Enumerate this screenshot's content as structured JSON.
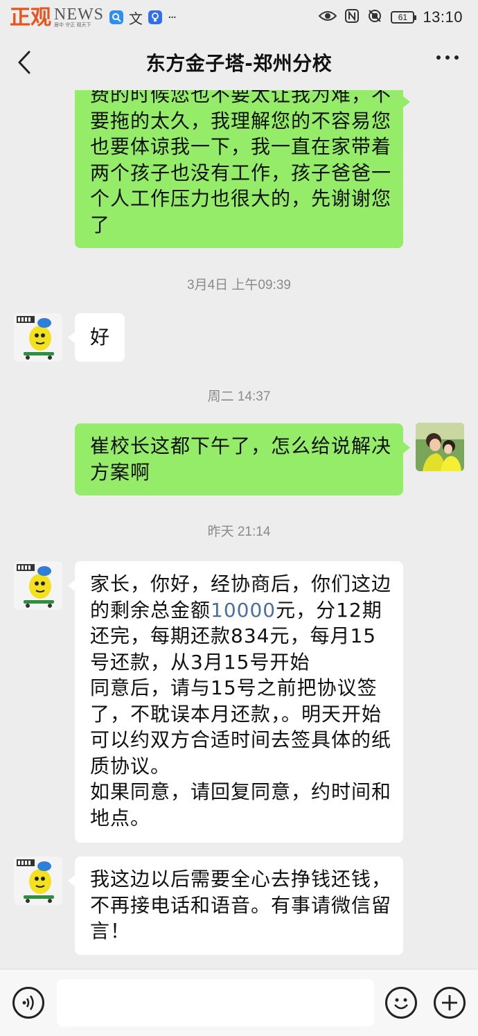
{
  "status_bar": {
    "watermark_main": "正观",
    "watermark_news": "NEWS",
    "watermark_slogan": "居中 守正 观天下",
    "icons": [
      "qq-icon",
      "translate-icon",
      "lightbulb-icon",
      "more-dots-icon",
      "eye-icon",
      "nfc-icon",
      "silent-icon",
      "battery-icon"
    ],
    "translate_glyph": "文",
    "more_glyph": "···",
    "battery_level": "61",
    "time": "13:10"
  },
  "nav": {
    "title": "东方金子塔-郑州分校"
  },
  "messages": [
    {
      "side": "right",
      "lines": [
        "费的时候您也不要太让我为难，不",
        "要拖的太久，我理解您的不容易您",
        "也要体谅我一下，我一直在家带着",
        "两个孩子也没有工作，孩子爸爸一",
        "个人工作压力也很大的，先谢谢您",
        "了"
      ]
    },
    {
      "timestamp": "3月4日 上午09:39"
    },
    {
      "side": "left",
      "lines": [
        "好"
      ]
    },
    {
      "timestamp": "周二 14:37"
    },
    {
      "side": "right",
      "lines": [
        "崔校长这都下午了，怎么给说解决",
        "方案啊"
      ]
    },
    {
      "timestamp": "昨天 21:14"
    },
    {
      "side": "left",
      "lines": [
        "家长，你好，经协商后，你们这边",
        "的剩余总金额10000元，分12期",
        "还完，每期还款834元，每月15",
        "号还款，从3月15号开始",
        "同意后，请与15号之前把协议签",
        "了，不耽误本月还款，。明天开始",
        "可以约双方合适时间去签具体的纸",
        "质协议。",
        "如果同意，请回复同意，约时间和",
        "地点。"
      ]
    },
    {
      "side": "left",
      "lines": [
        "我这边以后需要全心去挣钱还钱，",
        "不再接电话和语音。有事请微信留",
        "言！"
      ]
    }
  ],
  "input_bar": {
    "placeholder": ""
  },
  "colors": {
    "background": "#ededed",
    "sent_bubble": "#95ec69",
    "received_bubble": "#ffffff",
    "timestamp": "#8a8a8a",
    "watermark": "#e8541d"
  }
}
